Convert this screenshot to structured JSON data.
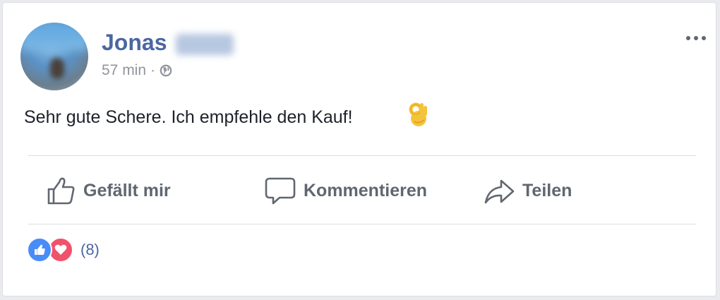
{
  "post": {
    "author_first_name": "Jonas",
    "time": "57 min",
    "separator": "·",
    "privacy_icon": "globe-icon",
    "text": "Sehr gute Schere. Ich empfehle den Kauf!",
    "emoji": "ok-hand-emoji"
  },
  "actions": {
    "like_label": "Gefällt mir",
    "comment_label": "Kommentieren",
    "share_label": "Teilen"
  },
  "reactions": {
    "types": [
      "like-icon",
      "love-icon"
    ],
    "count": "(8)"
  },
  "colors": {
    "name": "#4b67a1",
    "like": "#4a8cf7",
    "love": "#f0526c",
    "action_text": "#606770"
  }
}
